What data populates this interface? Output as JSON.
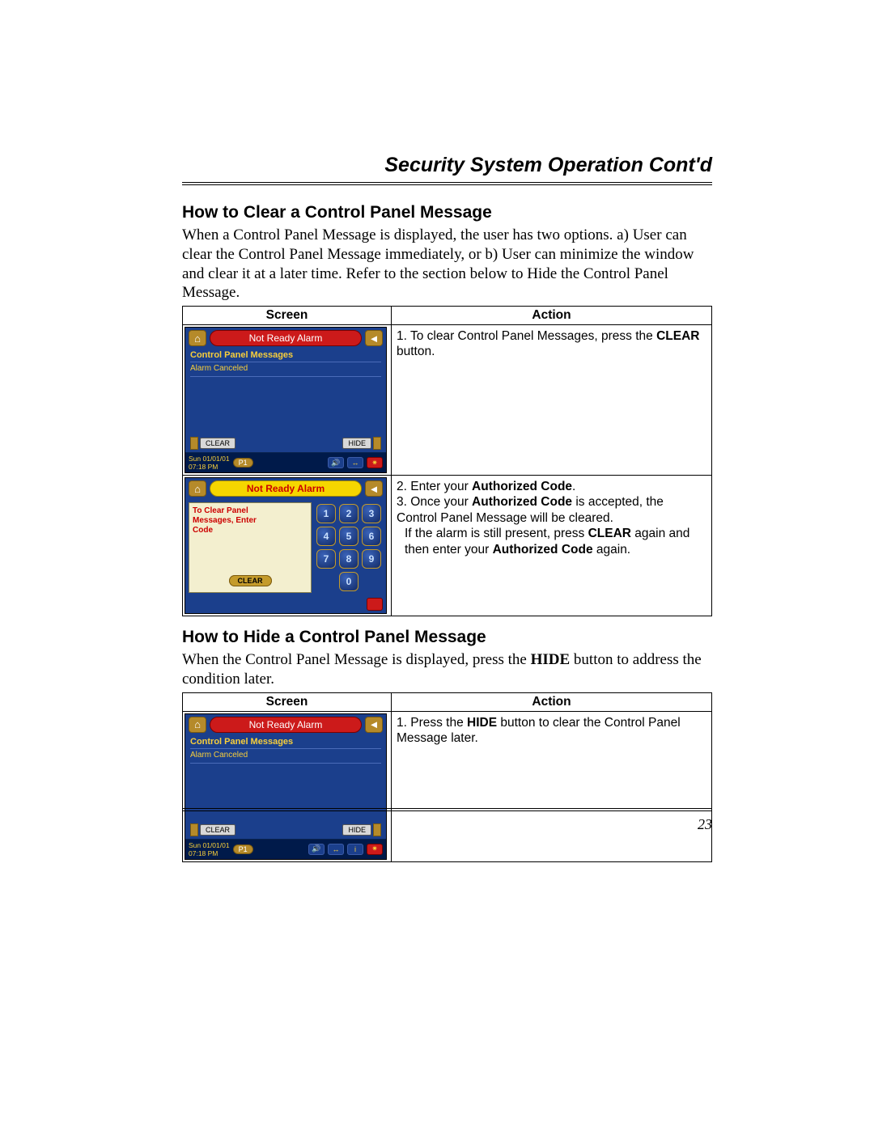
{
  "page": {
    "title": "Security System Operation Cont'd",
    "number": "23"
  },
  "section1": {
    "heading": "How to Clear a Control Panel Message",
    "intro": "When a Control Panel Message is displayed, the user has two options. a) User can clear the Control Panel Message immediately, or b) User can minimize the window and clear it at a later time. Refer to the section below to Hide the Control Panel Message.",
    "table_headers": {
      "screen": "Screen",
      "action": "Action"
    },
    "row1_action": {
      "num": "1.  ",
      "pre": "To clear Control Panel Messages, press the ",
      "bold": "CLEAR",
      "post": " button."
    },
    "row2": {
      "line2_num": "2.  ",
      "line2_pre": "Enter your ",
      "line2_bold": "Authorized Code",
      "line2_post": ".",
      "line3_num": "3.  ",
      "line3_pre": "Once your ",
      "line3_bold": "Authorized Code",
      "line3_post": " is accepted, the Control Panel Message will be cleared.",
      "line4_pre": "If the alarm is still present, press ",
      "line4_b1": "CLEAR",
      "line4_mid": " again and then enter your ",
      "line4_b2": "Authorized Code",
      "line4_post": " again."
    }
  },
  "section2": {
    "heading": "How to Hide a Control Panel Message",
    "intro_pre": "When the Control Panel Message is displayed, press the ",
    "intro_bold": "HIDE",
    "intro_post": " button to address the condition later.",
    "table_headers": {
      "screen": "Screen",
      "action": "Action"
    },
    "row1": {
      "num": "1. ",
      "pre": "Press the ",
      "bold": "HIDE",
      "post": " button to clear the Control Panel Message later."
    }
  },
  "device_a": {
    "title": "Not Ready Alarm",
    "sub": "Control Panel Messages",
    "msg": "Alarm Canceled",
    "clear": "CLEAR",
    "hide": "HIDE",
    "date": "Sun 01/01/01",
    "time": "07:18 PM",
    "p1": "P1"
  },
  "device_b": {
    "title": "Not Ready Alarm",
    "msg_l1": "To Clear Panel",
    "msg_l2": "Messages, Enter",
    "msg_l3": "Code",
    "clear": "CLEAR",
    "keys": [
      "1",
      "2",
      "3",
      "4",
      "5",
      "6",
      "7",
      "8",
      "9",
      "0"
    ]
  }
}
